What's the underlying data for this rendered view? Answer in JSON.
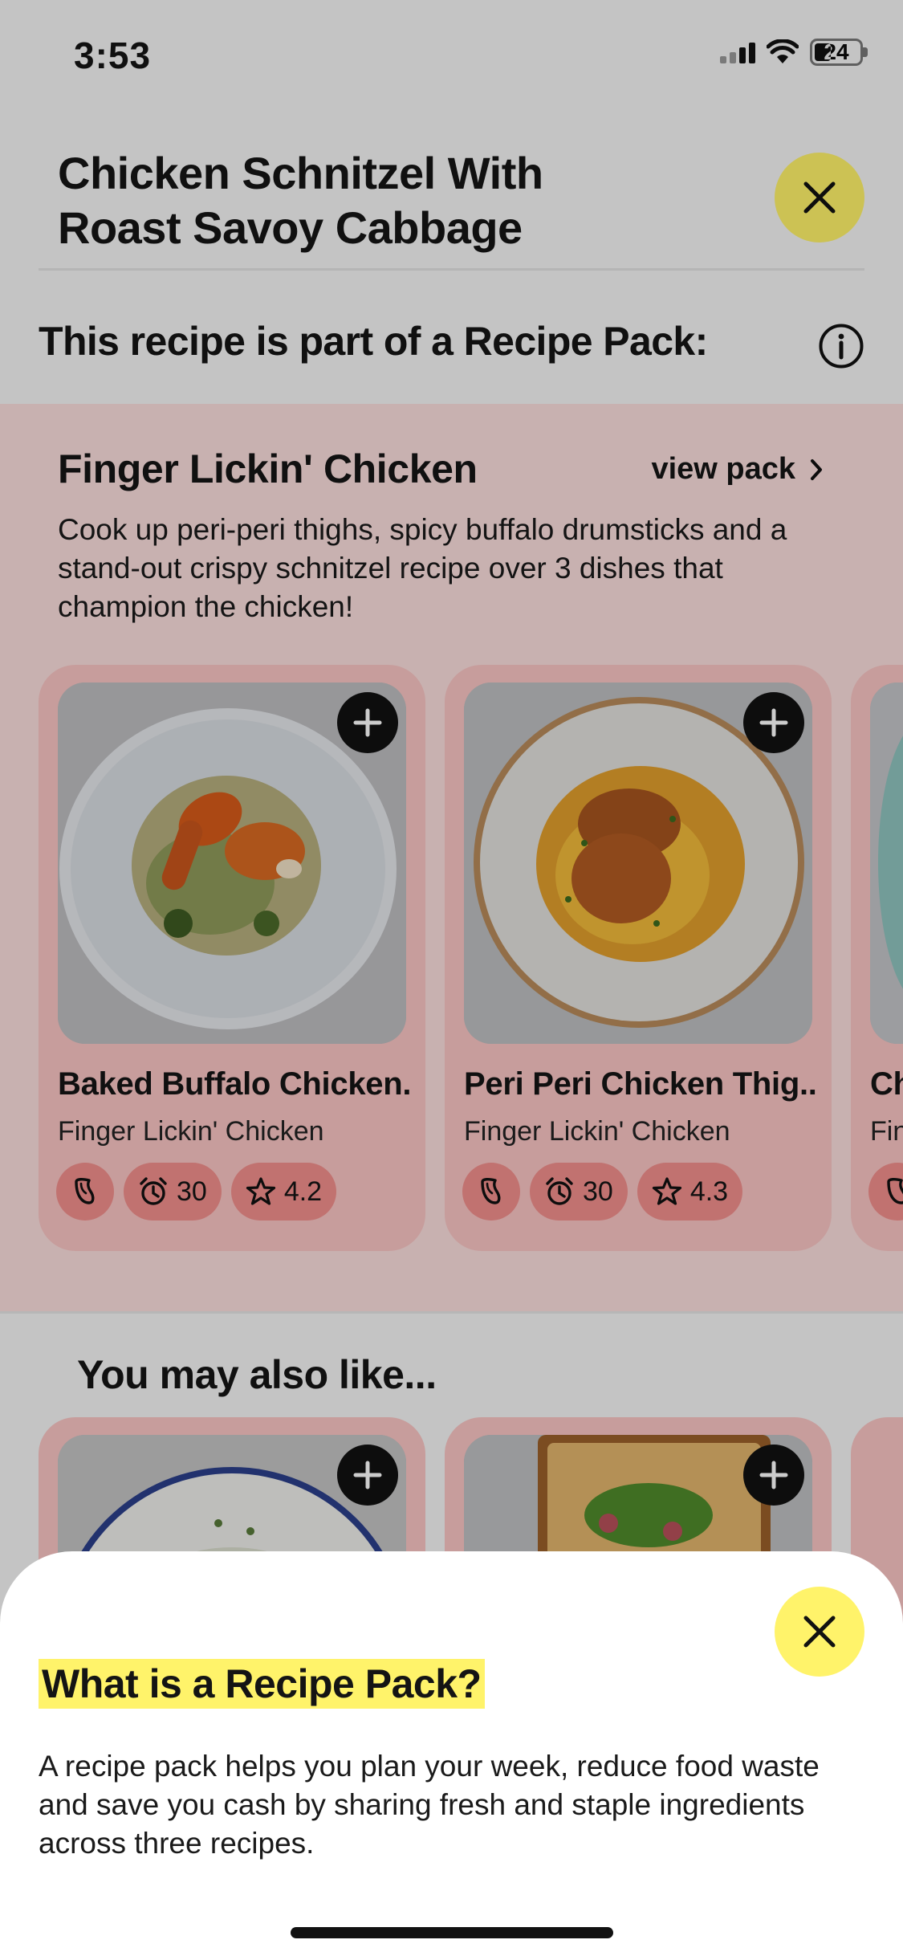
{
  "status_bar": {
    "time": "3:53",
    "battery": "24"
  },
  "header": {
    "title": "Chicken Schnitzel With Roast Savoy Cabbage"
  },
  "pack_note": {
    "text": "This recipe is part of a Recipe Pack:"
  },
  "pack": {
    "title": "Finger Lickin' Chicken",
    "view_label": "view pack",
    "description": "Cook up peri-peri thighs, spicy buffalo drumsticks and a stand-out crispy schnitzel recipe over 3 dishes that champion the chicken!",
    "cards": [
      {
        "title": "Baked Buffalo Chicken...",
        "subtitle": "Finger Lickin' Chicken",
        "time": "30",
        "rating": "4.2"
      },
      {
        "title": "Peri Peri Chicken Thig...",
        "subtitle": "Finger Lickin' Chicken",
        "time": "30",
        "rating": "4.3"
      },
      {
        "title": "Ch",
        "subtitle": "Fin"
      }
    ]
  },
  "also": {
    "title": "You may also like..."
  },
  "sheet": {
    "title": "What is a Recipe Pack?",
    "body": "A recipe pack helps you plan your week, reduce food waste and save you cash by sharing fresh and staple ingredients across three recipes."
  },
  "colors": {
    "accent_yellow": "#fff36a",
    "pack_bg": "#fbdedd",
    "card_bg": "#f9c5c4",
    "chip_bg": "#f28f8c"
  }
}
